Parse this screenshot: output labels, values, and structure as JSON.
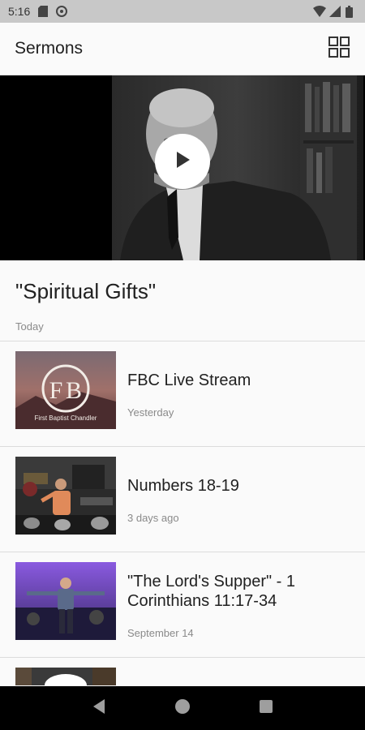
{
  "status_bar": {
    "time": "5:16",
    "left_icons": [
      "sd-card-icon",
      "cast-icon"
    ],
    "right_icons": [
      "wifi-icon",
      "signal-icon",
      "battery-icon"
    ]
  },
  "app_bar": {
    "title": "Sermons",
    "grid_icon": "grid-view-icon"
  },
  "hero": {
    "play_icon": "play-icon"
  },
  "featured": {
    "title": "\"Spiritual Gifts\"",
    "date": "Today"
  },
  "sermons": [
    {
      "title": "FBC Live Stream",
      "date": "Yesterday",
      "thumb_text": "First Baptist Chandler"
    },
    {
      "title": "Numbers 18-19",
      "date": "3 days ago"
    },
    {
      "title": "\"The Lord's Supper\" - 1 Corinthians 11:17-34",
      "date": "September 14"
    }
  ],
  "nav_bar": {
    "back_icon": "back-triangle-icon",
    "home_icon": "home-circle-icon",
    "recents_icon": "recents-square-icon"
  },
  "colors": {
    "status_bar": "#c8c8c8",
    "background": "#fafafa",
    "divider": "#dcdcdc",
    "secondary_text": "#8a8a8a",
    "nav_bar": "#000000"
  }
}
